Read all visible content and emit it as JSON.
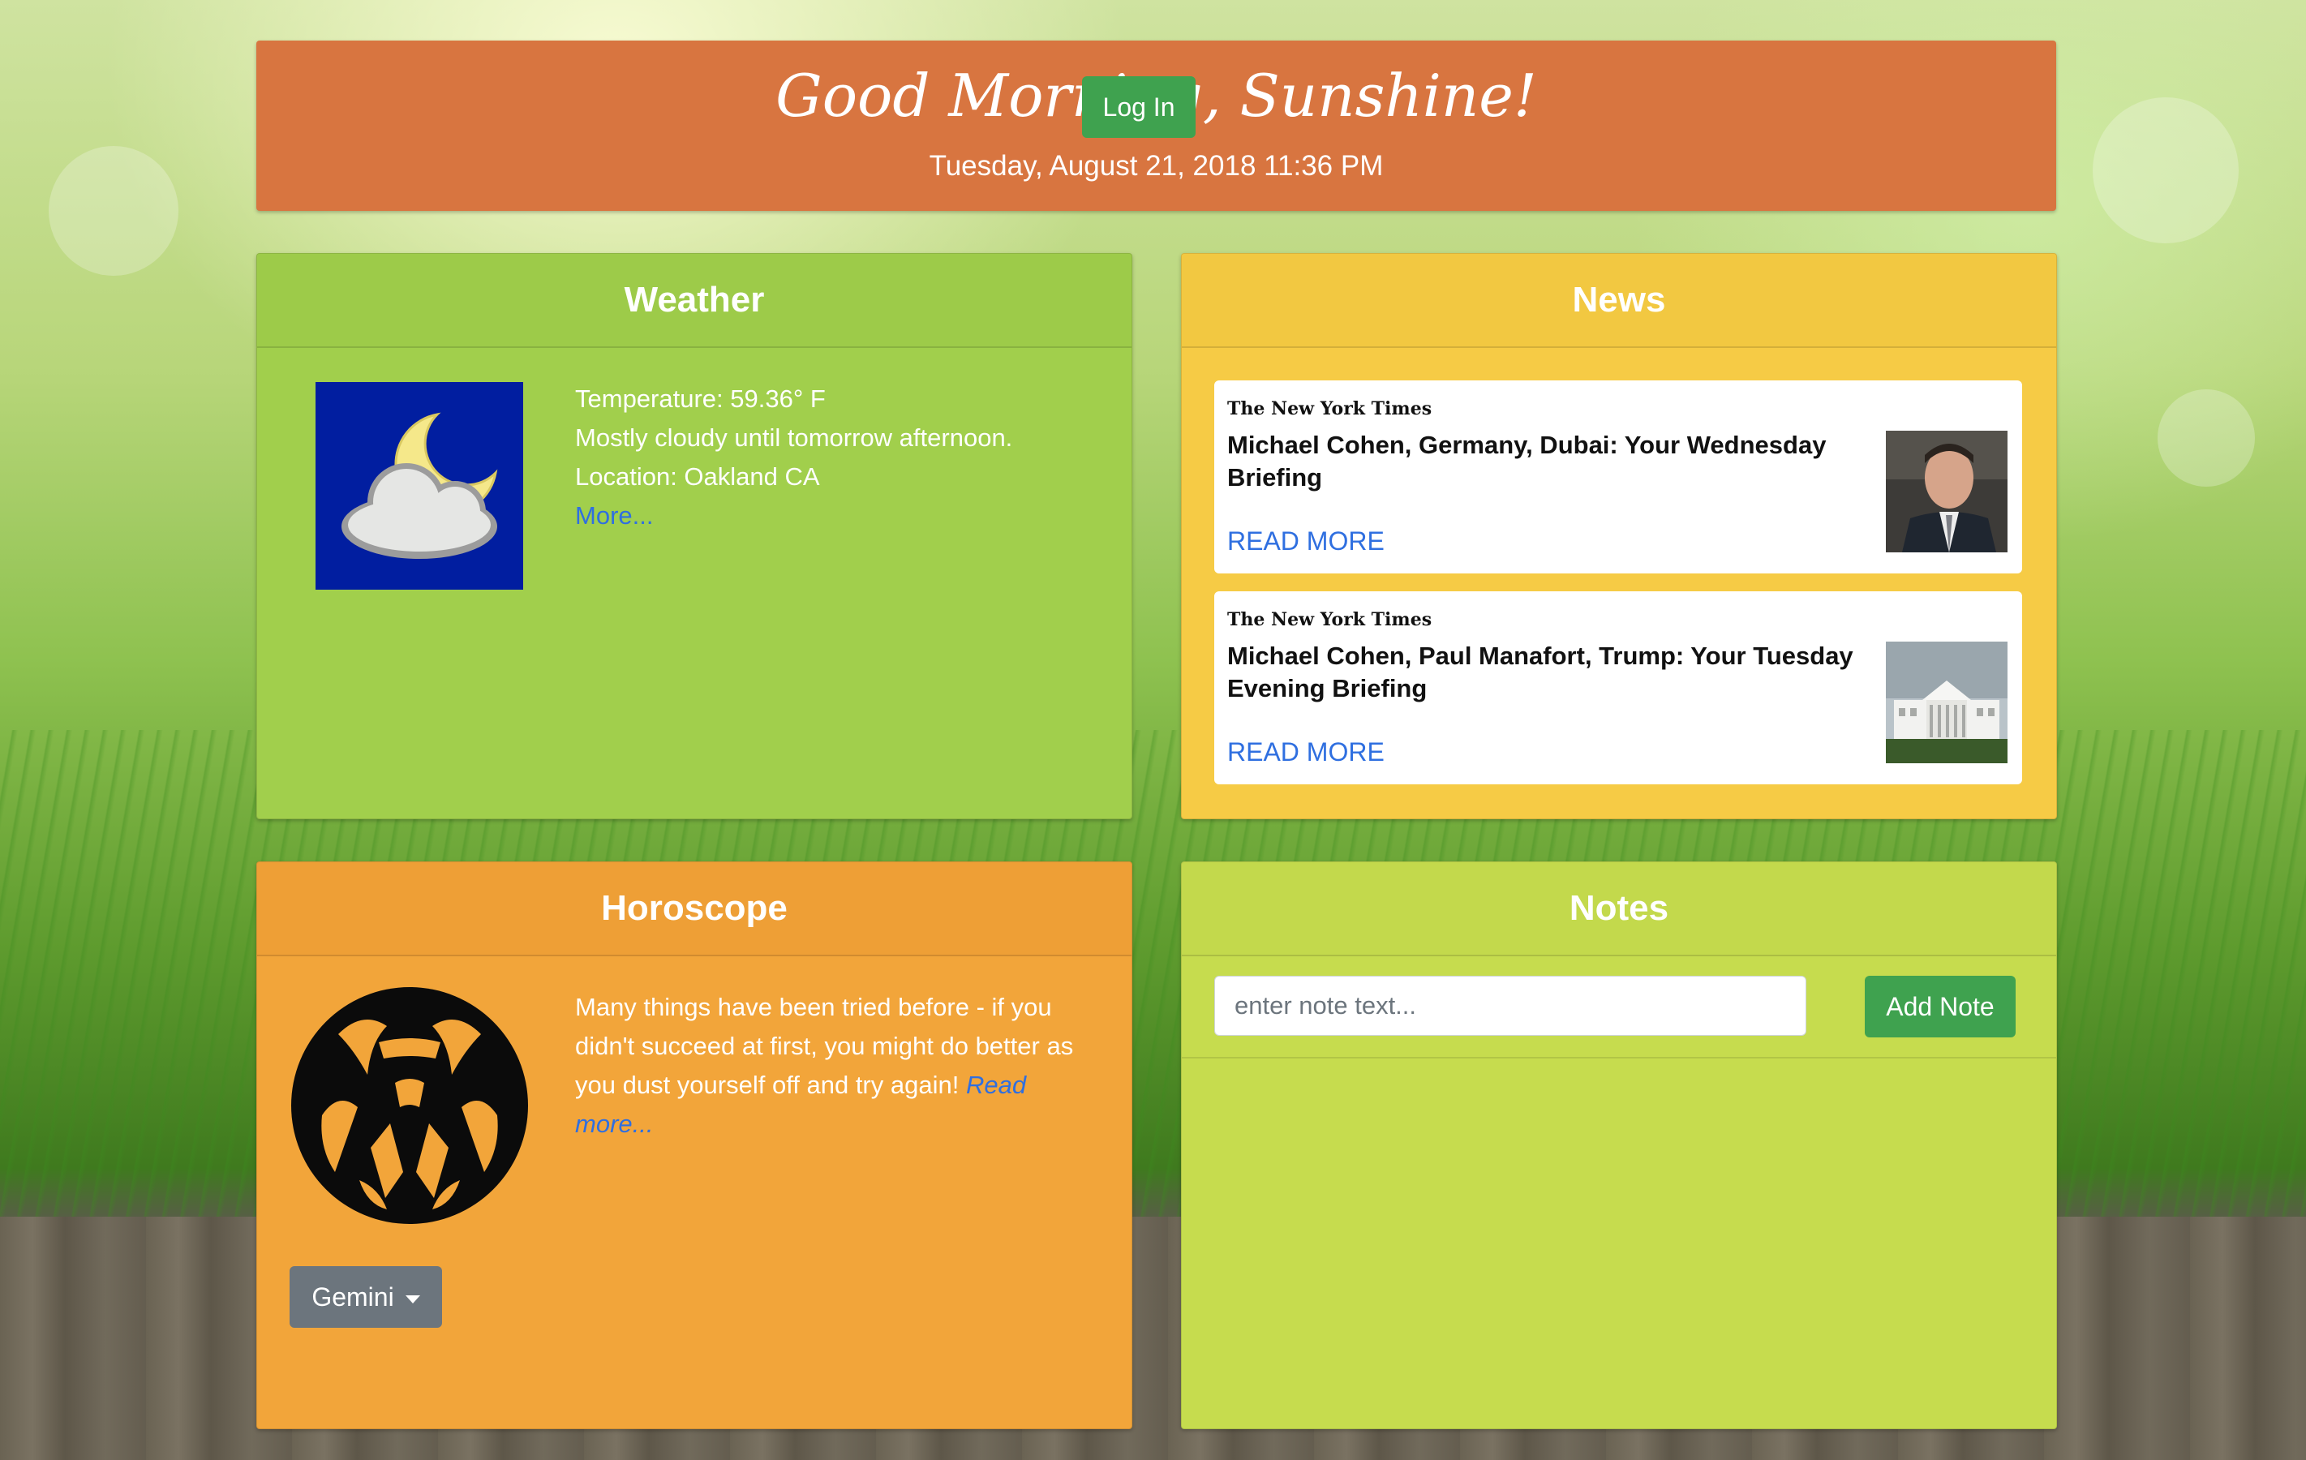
{
  "header": {
    "greeting": "Good Morning, Sunshine!",
    "datetime": "Tuesday, August 21, 2018 11:36 PM",
    "login_label": "Log In"
  },
  "weather": {
    "title": "Weather",
    "icon": "partly-cloudy-night-icon",
    "temperature": "Temperature: 59.36° F",
    "summary": "Mostly cloudy until tomorrow afternoon.",
    "location": "Location: Oakland CA",
    "more_label": "More..."
  },
  "news": {
    "title": "News",
    "items": [
      {
        "source": "The New York Times",
        "headline": "Michael Cohen, Germany, Dubai: Your Wednesday Briefing",
        "read_more": "READ MORE",
        "thumbnail": "man-portrait-thumbnail"
      },
      {
        "source": "The New York Times",
        "headline": "Michael Cohen, Paul Manafort, Trump: Your Tuesday Evening Briefing",
        "read_more": "READ MORE",
        "thumbnail": "white-house-thumbnail"
      }
    ]
  },
  "horoscope": {
    "title": "Horoscope",
    "icon": "gemini-zodiac-icon",
    "text": "Many things have been tried before - if you didn't succeed at first, you might do better as you dust yourself off and try again!",
    "read_more": "Read more...",
    "selected_sign": "Gemini"
  },
  "notes": {
    "title": "Notes",
    "input_placeholder": "enter note text...",
    "input_value": "",
    "add_label": "Add Note"
  },
  "colors": {
    "header": "#d87540",
    "weather": "#a1cf4c",
    "news": "#f6cb45",
    "horoscope": "#f2a53a",
    "notes": "#c6dc4e",
    "button_green": "#3fa24f",
    "link_blue": "#2f6fe0"
  }
}
